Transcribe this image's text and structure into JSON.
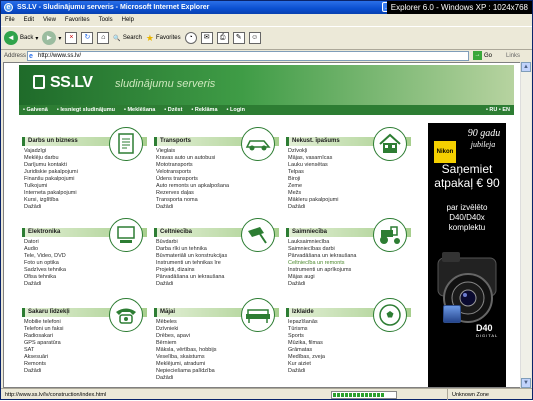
{
  "window": {
    "title": "SS.LV - Sludinājumu serveris - Microsoft Internet Explorer",
    "watermark": "Explorer 6.0 - Windows XP : 1024x768"
  },
  "menu": [
    "File",
    "Edit",
    "View",
    "Favorites",
    "Tools",
    "Help"
  ],
  "toolbar": {
    "back": "Back",
    "search": "Search",
    "favorites": "Favorites"
  },
  "address": {
    "label": "Address",
    "url": "http://www.ss.lv/",
    "go": "Go",
    "links": "Links"
  },
  "site": {
    "logo": "SS.LV",
    "tagline": "sludinājumu serveris",
    "nav": [
      "• Galvenā",
      "• Iesniegt sludinājumu",
      "• Meklēšana",
      "• Dzēst",
      "• Reklāma",
      "• Login"
    ],
    "lang": "• RU • EN"
  },
  "categories": [
    {
      "title": "Darbs un bizness",
      "icon": "document-icon",
      "items": [
        "Vajadzīgi",
        "Meklēju darbu",
        "Darījumu kontakti",
        "Juridiskie pakalpojumi",
        "Finanšu pakalpojumi",
        "Tulkojumi",
        "Interneta pakalpojumi",
        "Kursi, izglītība",
        "Dažādi"
      ]
    },
    {
      "title": "Transports",
      "icon": "car-icon",
      "items": [
        "Vieglais",
        "Kravas auto un autobusi",
        "Mototransports",
        "Velotransports",
        "Ūdens transports",
        "Auto remonts un apkalpošana",
        "Rezerves daļas",
        "Transporta noma",
        "Dažādi"
      ]
    },
    {
      "title": "Nekust. īpašums",
      "icon": "house-icon",
      "items": [
        "Dzīvokļi",
        "Mājas, vasarnīcas",
        "Lauku viensētas",
        "Telpas",
        "Biroji",
        "Zeme",
        "Mežs",
        "Mākleru pakalpojumi",
        "Dažādi"
      ]
    },
    {
      "title": "Elektronika",
      "icon": "computer-icon",
      "items": [
        "Datori",
        "Audio",
        "Tele, Video, DVD",
        "Foto un optika",
        "Sadzīves tehnika",
        "Ofisa tehnika",
        "Dažādi"
      ]
    },
    {
      "title": "Celtniecība",
      "icon": "trowel-icon",
      "items": [
        "Būvdarbi",
        "Darba rīki un tehnika",
        "Būvmateriāli un konstrukcijas",
        "Instrumenti un tehnikas īre",
        "Projekti, dizains",
        "Pārvadāšana un iekraušana",
        "Dažādi"
      ]
    },
    {
      "title": "Saimniecība",
      "icon": "tractor-icon",
      "items": [
        "Lauksaimniecība",
        "Saimniecības darbi",
        "Pārvadāšana un iekraušana",
        "Celtniecība un remonts",
        "Instrumenti un aprīkojums",
        "Mājas augi",
        "Dažādi"
      ]
    },
    {
      "title": "Sakaru līdzekļi",
      "icon": "telephone-icon",
      "items": [
        "Mobilie telefoni",
        "Telefoni un faksi",
        "Radiosakari",
        "GPS aparatūra",
        "SAT",
        "Aksesuāri",
        "Remonts",
        "Dažādi"
      ]
    },
    {
      "title": "Mājai",
      "icon": "sofa-icon",
      "items": [
        "Mēbeles",
        "Dzīvnieki",
        "Drēbes, apavi",
        "Bērniem",
        "Māksla, vērtības, hobbijs",
        "Veselība, skaistums",
        "Meklējumi, atradumi",
        "Nepieciešama palīdzība",
        "Dažādi"
      ]
    },
    {
      "title": "Izklaide",
      "icon": "football-icon",
      "items": [
        "Iepazīšanās",
        "Tūrisms",
        "Sports",
        "Mūzika, filmas",
        "Grāmatas",
        "Medības, zveja",
        "Kur aiziet",
        "Dažādi"
      ]
    }
  ],
  "ad": {
    "brand": "Nikon",
    "years_line1": "90 gadu",
    "years_line2": "jubileja",
    "line1": "Saņemiet",
    "line2": "atpakaļ € 90",
    "line3": "par izvēlēto",
    "line4": "D40/D40x",
    "line5": "komplektu",
    "model": "D40",
    "digital": "DIGITAL"
  },
  "status": {
    "text": "http://www.ss.lv/lv/construction/index.html",
    "zone": "Unknown Zone",
    "progress": 0.9
  }
}
